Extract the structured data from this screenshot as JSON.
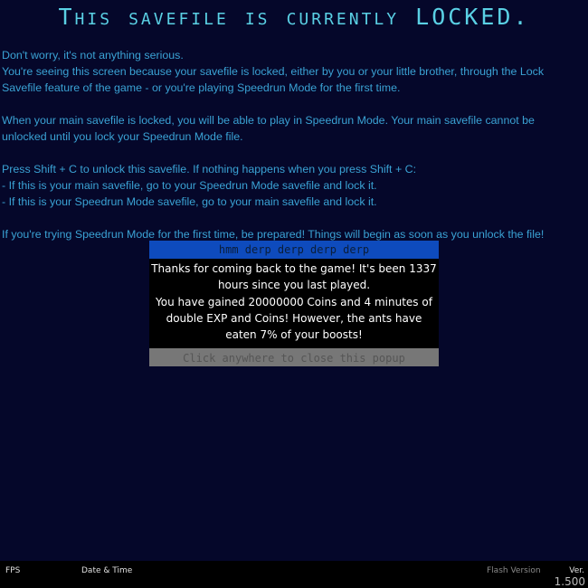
{
  "title": "This savefile is currently LOCKED.",
  "info": {
    "line1": "Don't worry, it's not anything serious.",
    "line2": "You're seeing this screen because your savefile is locked, either by you or your little brother, through the Lock Savefile feature of the game - or you're playing Speedrun Mode for the first time.",
    "para2": "When your main savefile is locked, you will be able to play in Speedrun Mode. Your main savefile cannot be unlocked until you lock your Speedrun Mode file.",
    "para3_line1": "Press Shift + C to unlock this savefile. If nothing happens when you press Shift + C:",
    "para3_line2": "- If this is your main savefile, go to your Speedrun Mode savefile and lock it.",
    "para3_line3": "- If this is your Speedrun Mode savefile, go to your main savefile and lock it.",
    "para4": "If you're trying Speedrun Mode for the first time, be prepared! Things will begin as soon as you unlock the file!"
  },
  "popup": {
    "header": "hmm derp derp derp derp",
    "body_line1": "Thanks for coming back to the game! It's been 1337 hours since you last played.",
    "body_line2": "You have gained 20000000 Coins and 4 minutes of double EXP and Coins! However, the ants have eaten 7% of your boosts!",
    "close_label": "Click anywhere to close this popup"
  },
  "footer": {
    "fps_label": "FPS",
    "datetime_label": "Date & Time",
    "flash_label": "Flash Version",
    "ver_label": "Ver.",
    "ver_value": "1.500"
  },
  "colors": {
    "background": "#05072a",
    "title": "#5ad0e4",
    "info_text": "#3aa2d4",
    "popup_header": "#0e4bbd",
    "popup_close": "#777777"
  }
}
